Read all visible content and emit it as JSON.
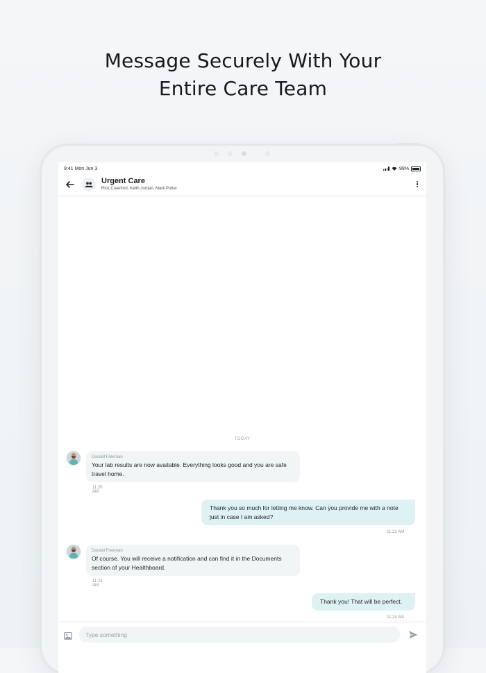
{
  "headline": {
    "line1": "Message Securely With Your",
    "line2": "Entire Care Team"
  },
  "status_bar": {
    "time": "9:41",
    "date": "Mon Jun 3",
    "battery": "99%"
  },
  "chat_header": {
    "title": "Urgent Care",
    "members": "Rick Crawford, Keith Jordan, Mark Potter",
    "back_icon": "arrow-left-icon",
    "group_icon": "group-icon",
    "menu_icon": "more-vertical-icon"
  },
  "feed": {
    "date_divider": "TODAY",
    "messages": [
      {
        "direction": "incoming",
        "sender": "Donald Freeman",
        "text": "Your lab results are now available. Everything looks good and you are safe travel home.",
        "time": "11:20 AM"
      },
      {
        "direction": "outgoing",
        "text": "Thank you so much for letting me know. Can you provide me with a note just in case I am asked?",
        "time": "11:22 AM"
      },
      {
        "direction": "incoming",
        "sender": "Donald Freeman",
        "text": "Of course. You will receive a notification and can find it in the Documents section of your Healthboard.",
        "time": "11:23 AM"
      },
      {
        "direction": "outgoing",
        "text": "Thank you! That will be perfect.",
        "time": "11:24 AM"
      }
    ]
  },
  "composer": {
    "placeholder": "Type something",
    "value": "",
    "attach_icon": "image-icon",
    "send_icon": "send-icon"
  },
  "colors": {
    "incoming_bubble": "#f2f5f6",
    "outgoing_bubble": "#def2f4",
    "accent": "#5fb3b0"
  }
}
